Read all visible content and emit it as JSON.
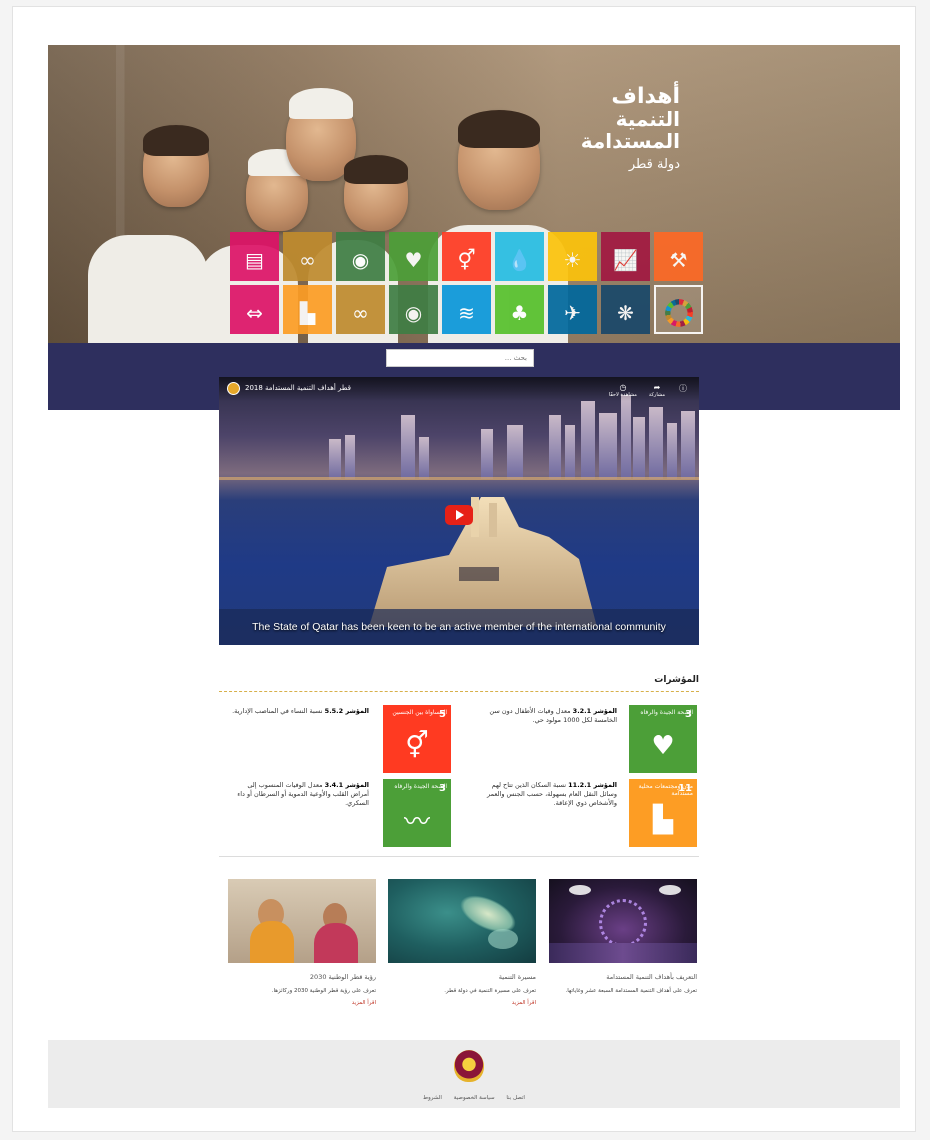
{
  "hero": {
    "title_line1": "أهداف",
    "title_line2": "التنمية",
    "title_line3": "المستدامة",
    "title_line4": "دولة قطر"
  },
  "sdg_tiles": [
    {
      "color": "#dd1367",
      "icon": "equality-icon"
    },
    {
      "color": "#bf8b2e",
      "icon": "consumption-icon"
    },
    {
      "color": "#3f7e44",
      "icon": "climate-icon"
    },
    {
      "color": "#4c9f38",
      "icon": "health-icon"
    },
    {
      "color": "#ff3a21",
      "icon": "gender-icon"
    },
    {
      "color": "#26bde2",
      "icon": "water-icon"
    },
    {
      "color": "#fcc30b",
      "icon": "energy-icon"
    },
    {
      "color": "#a21942",
      "icon": "growth-icon"
    },
    {
      "color": "#fd6925",
      "icon": "industry-icon"
    },
    {
      "color": "#dd1367",
      "icon": "inequality-icon"
    },
    {
      "color": "#fd9d24",
      "icon": "cities-icon"
    },
    {
      "color": "#bf8b2e",
      "icon": "consumption-loop-icon"
    },
    {
      "color": "#3f7e44",
      "icon": "eye-icon"
    },
    {
      "color": "#0a97d9",
      "icon": "fish-icon"
    },
    {
      "color": "#56c02b",
      "icon": "tree-icon"
    },
    {
      "color": "#00689d",
      "icon": "dove-icon"
    },
    {
      "color": "#19486a",
      "icon": "partnership-icon"
    },
    {
      "color": "#ffffff",
      "icon": "sdg-wheel-icon"
    }
  ],
  "search": {
    "placeholder": "بحث ..."
  },
  "video": {
    "title": "قطر أهداف التنمية المستدامة 2018",
    "caption": "The State of Qatar has been keen to be an active member of the international community",
    "watch_later": "مشاهدة لاحقًا",
    "share": "مشاركة"
  },
  "indicators": {
    "title": "المؤشرات",
    "items": [
      {
        "color": "#4c9f38",
        "num": "3",
        "icon": "wellbeing-icon",
        "label": "الصحة الجيدة والرفاه",
        "text_bold": "المؤشر 3.2.1",
        "text": "معدل وفيات الأطفال دون سن الخامسة لكل 1000 مولود حي."
      },
      {
        "color": "#ff3a21",
        "num": "5",
        "icon": "gender-equality-icon",
        "label": "المساواة بين الجنسين",
        "text_bold": "المؤشر 5.5.2",
        "text": "نسبة النساء في المناصب الإدارية."
      },
      {
        "color": "#fd9d24",
        "num": "11",
        "icon": "sustainable-cities-icon",
        "label": "مدن ومجتمعات محلية مستدامة",
        "text_bold": "المؤشر 11.2.1",
        "text": "نسبة السكان الذين تتاح لهم وسائل النقل العام بسهولة، حسب الجنس والعمر والأشخاص ذوي الإعاقة."
      },
      {
        "color": "#4c9f38",
        "num": "3",
        "icon": "heartbeat-icon",
        "label": "الصحة الجيدة والرفاه",
        "text_bold": "المؤشر 3.4.1",
        "text": "معدل الوفيات المنسوب إلى أمراض القلب والأوعية الدموية أو السرطان أو داء السكري."
      }
    ]
  },
  "cards": [
    {
      "title": "التعريف بأهداف التنمية المستدامة",
      "desc": "تعرف على أهداف التنمية المستدامة السبعة عشر وغاياتها.",
      "link": "اقرأ المزيد"
    },
    {
      "title": "مسيرة التنمية",
      "desc": "تعرف على مسيرة التنمية في دولة قطر.",
      "link": "اقرأ المزيد"
    },
    {
      "title": "رؤية قطر الوطنية 2030",
      "desc": "تعرف على رؤية قطر الوطنية 2030 وركائزها.",
      "link": "اقرأ المزيد"
    }
  ],
  "footer": {
    "links": [
      "اتصل بنا",
      "سياسة الخصوصية",
      "الشروط"
    ]
  }
}
